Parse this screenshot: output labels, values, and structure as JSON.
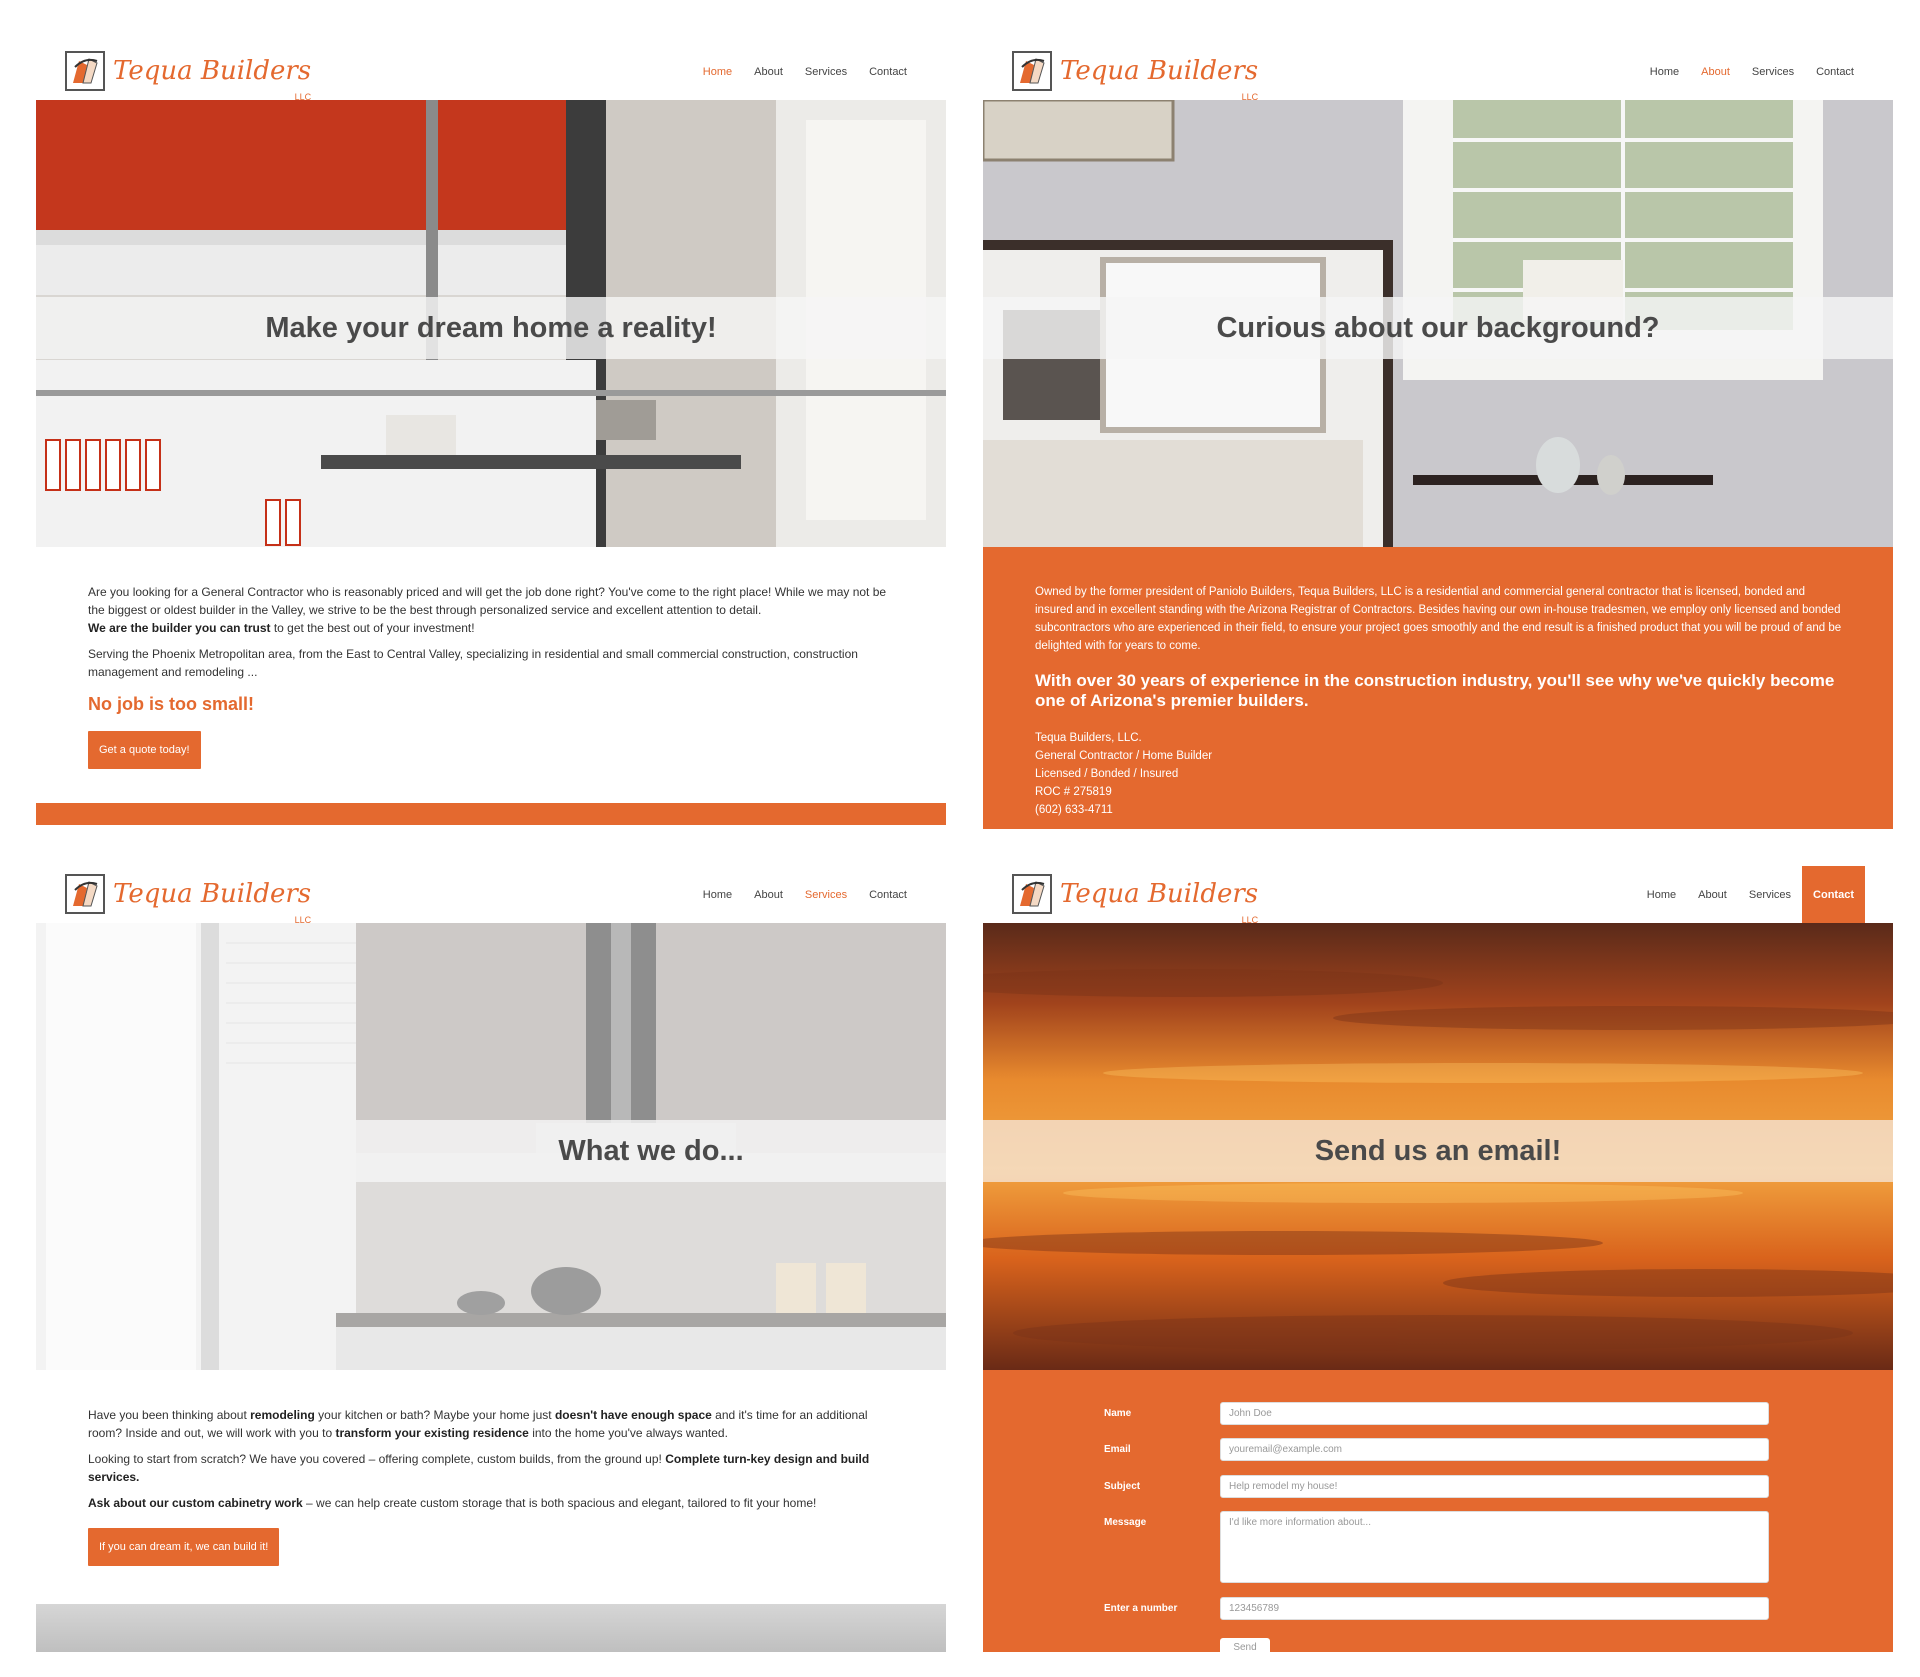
{
  "brand": {
    "name": "Tequa Builders",
    "suffix": "LLC"
  },
  "nav": [
    "Home",
    "About",
    "Services",
    "Contact"
  ],
  "home": {
    "active_nav": "Home",
    "hero_title": "Make your dream home a reality!",
    "p1_text": "Are you looking for a General Contractor who is reasonably priced and will get the job done right? You've come to the right place! While we may not be the biggest or oldest builder in the Valley, we strive to be the best through personalized service and excellent attention to detail.",
    "p1_bold": "We are the builder you can trust",
    "p1_tail": " to get the best out of your investment!",
    "p2": "Serving the Phoenix Metropolitan area, from the East to Central Valley, specializing in residential and small commercial construction, construction management and remodeling ...",
    "cta_title": "No job is too small!",
    "button": "Get a quote today!"
  },
  "about": {
    "active_nav": "About",
    "hero_title": "Curious about our background?",
    "body": "Owned by the former president of Paniolo Builders, Tequa Builders, LLC is a residential and commercial general contractor that is licensed, bonded and insured and in excellent standing with the Arizona Registrar of Contractors. Besides having our own in-house tradesmen, we employ only licensed and bonded subcontractors who are experienced in their field, to ensure your project goes smoothly and the end result is a finished product that you will be proud of and be delighted with for years to come.",
    "headline": "With over 30 years of experience in the construction industry, you'll see why we've quickly become one of Arizona's premier builders.",
    "contact_lines": [
      "Tequa Builders, LLC.",
      "General Contractor / Home Builder",
      "Licensed / Bonded / Insured",
      "ROC # 275819",
      "(602) 633-4711"
    ]
  },
  "services": {
    "active_nav": "Services",
    "hero_title": "What we do...",
    "p1": {
      "a": "Have you been thinking about ",
      "b": "remodeling",
      "c": " your kitchen or bath? Maybe your home just ",
      "d": "doesn't have enough space",
      "e": " and it's time for an additional room? Inside and out, we will work with you to ",
      "f": "transform your existing residence",
      "g": " into the home you've always wanted."
    },
    "p2": {
      "a": "Looking to start from scratch? We have you covered – offering complete, custom builds, from the ground up! ",
      "b": "Complete turn-key design and build services."
    },
    "p3": {
      "a": "Ask about our custom cabinetry work",
      "b": " – we can help create custom storage that is both spacious and elegant, tailored to fit your home!"
    },
    "button": "If you can dream it, we can build it!"
  },
  "contact": {
    "active_nav": "Contact",
    "hero_title": "Send us an email!",
    "fields": [
      {
        "label": "Name",
        "placeholder": "John Doe"
      },
      {
        "label": "Email",
        "placeholder": "youremail@example.com"
      },
      {
        "label": "Subject",
        "placeholder": "Help remodel my house!"
      },
      {
        "label": "Message",
        "placeholder": "I'd like more information about..."
      },
      {
        "label": "Enter a number",
        "placeholder": "123456789"
      }
    ],
    "send": "Send"
  },
  "colors": {
    "accent": "#e4692f",
    "hero_band": "#f5f5f5"
  }
}
